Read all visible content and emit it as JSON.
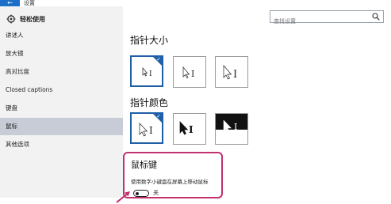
{
  "window": {
    "title": "设置",
    "back_icon": "arrow-left-icon"
  },
  "sidebar": {
    "header": {
      "icon": "gear-icon",
      "label": "轻松使用"
    },
    "items": [
      {
        "label": "讲述人"
      },
      {
        "label": "放大镜"
      },
      {
        "label": "高对比度"
      },
      {
        "label": "Closed captions"
      },
      {
        "label": "键盘"
      },
      {
        "label": "鼠标",
        "active": true
      },
      {
        "label": "其他选项"
      }
    ]
  },
  "search": {
    "placeholder": "查找设置",
    "icon": "search-icon"
  },
  "pointer_size": {
    "title": "指针大小",
    "options": [
      {
        "name": "small",
        "selected": true
      },
      {
        "name": "medium",
        "selected": false
      },
      {
        "name": "large",
        "selected": false
      }
    ]
  },
  "pointer_color": {
    "title": "指针颜色",
    "options": [
      {
        "name": "white",
        "selected": true
      },
      {
        "name": "black",
        "selected": false
      },
      {
        "name": "inverted",
        "selected": false
      }
    ]
  },
  "mouse_keys": {
    "title": "鼠标键",
    "description": "使用数字小键盘在屏幕上移动鼠标",
    "toggle_state": "关",
    "toggle_on": false
  },
  "colors": {
    "accent": "#1f5fa8",
    "highlight": "#c2306f",
    "sidebar_active": "#c7ccd6",
    "sidebar_bg": "#f2f2f2"
  }
}
